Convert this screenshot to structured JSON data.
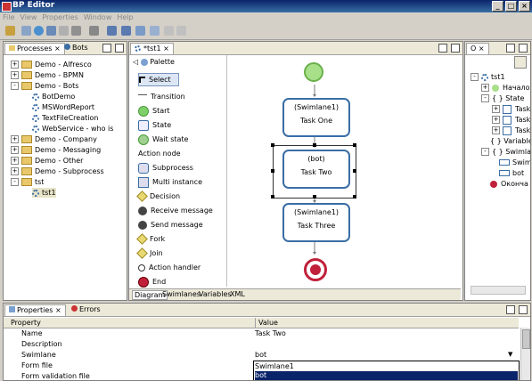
{
  "window": {
    "title": "BP Editor"
  },
  "menu": [
    "File",
    "View",
    "Properties",
    "Window",
    "Help"
  ],
  "left_panel": {
    "tabs": [
      "Processes",
      "Bots"
    ],
    "tree": [
      {
        "label": "Demo - Alfresco",
        "level": 0,
        "kind": "folder",
        "expander": "+"
      },
      {
        "label": "Demo - BPMN",
        "level": 0,
        "kind": "folder",
        "expander": "+"
      },
      {
        "label": "Demo - Bots",
        "level": 0,
        "kind": "folder",
        "expander": "-"
      },
      {
        "label": "BotDemo",
        "level": 1,
        "kind": "process"
      },
      {
        "label": "MSWordReport",
        "level": 1,
        "kind": "process"
      },
      {
        "label": "TextFileCreation",
        "level": 1,
        "kind": "process"
      },
      {
        "label": "WebService - who is",
        "level": 1,
        "kind": "process"
      },
      {
        "label": "Demo - Company",
        "level": 0,
        "kind": "folder",
        "expander": "+"
      },
      {
        "label": "Demo - Messaging",
        "level": 0,
        "kind": "folder",
        "expander": "+"
      },
      {
        "label": "Demo - Other",
        "level": 0,
        "kind": "folder",
        "expander": "+"
      },
      {
        "label": "Demo - Subprocess",
        "level": 0,
        "kind": "folder",
        "expander": "+"
      },
      {
        "label": "tst",
        "level": 0,
        "kind": "folder",
        "expander": "-"
      },
      {
        "label": "tst1",
        "level": 1,
        "kind": "process",
        "selected": true
      }
    ]
  },
  "editor": {
    "tab": "*tst1",
    "palette_title": "Palette",
    "palette": [
      {
        "label": "Select",
        "icon": "cursor-icon",
        "selected": true
      },
      {
        "label": "Transition",
        "icon": "arrow-icon"
      },
      {
        "label": "Start",
        "icon": "start-icon"
      },
      {
        "label": "State",
        "icon": "state-icon"
      },
      {
        "label": "Wait state",
        "icon": "wait-icon"
      },
      {
        "label": "Action node",
        "icon": ""
      },
      {
        "label": "Subprocess",
        "icon": "subprocess-icon"
      },
      {
        "label": "Multi instance",
        "icon": "multi-icon"
      },
      {
        "label": "Decision",
        "icon": "decision-icon"
      },
      {
        "label": "Receive message",
        "icon": "receive-icon"
      },
      {
        "label": "Send message",
        "icon": "send-icon"
      },
      {
        "label": "Fork",
        "icon": "fork-icon"
      },
      {
        "label": "Join",
        "icon": "join-icon"
      },
      {
        "label": "Action handler",
        "icon": "handler-icon"
      },
      {
        "label": "End",
        "icon": "end-icon"
      }
    ],
    "nodes": [
      {
        "lane": "(Swimlane1)",
        "name": "Task One"
      },
      {
        "lane": "(bot)",
        "name": "Task Two"
      },
      {
        "lane": "(Swimlane1)",
        "name": "Task Three"
      }
    ],
    "bottom_tabs": [
      "Diagram",
      "Swimlanes",
      "Variables",
      "XML"
    ]
  },
  "outline": {
    "tab": "O",
    "tree": [
      {
        "label": "tst1",
        "level": 0
      },
      {
        "label": "Начало",
        "level": 1
      },
      {
        "label": "State",
        "level": 1
      },
      {
        "label": "Task",
        "level": 2
      },
      {
        "label": "Task",
        "level": 2
      },
      {
        "label": "Task",
        "level": 2
      },
      {
        "label": "Variable",
        "level": 1
      },
      {
        "label": "Swimlan",
        "level": 1
      },
      {
        "label": "Swim",
        "level": 2
      },
      {
        "label": "bot",
        "level": 2
      },
      {
        "label": "Оконча",
        "level": 1
      }
    ]
  },
  "properties": {
    "tabs": [
      "Properties",
      "Errors"
    ],
    "columns": [
      "Property",
      "Value"
    ],
    "rows": [
      {
        "property": "Name",
        "value": "Task Two"
      },
      {
        "property": "Description",
        "value": ""
      },
      {
        "property": "Swimlane",
        "value": "bot"
      },
      {
        "property": "Form file",
        "value": ""
      },
      {
        "property": "Form validation file",
        "value": ""
      }
    ],
    "dropdown_options": [
      "Swimlane1",
      "bot"
    ],
    "dropdown_selected": "bot"
  },
  "colors": {
    "accent": "#3a6ea5",
    "start": "#7fcf6a",
    "end": "#c0203a",
    "selection": "#0a246a"
  }
}
